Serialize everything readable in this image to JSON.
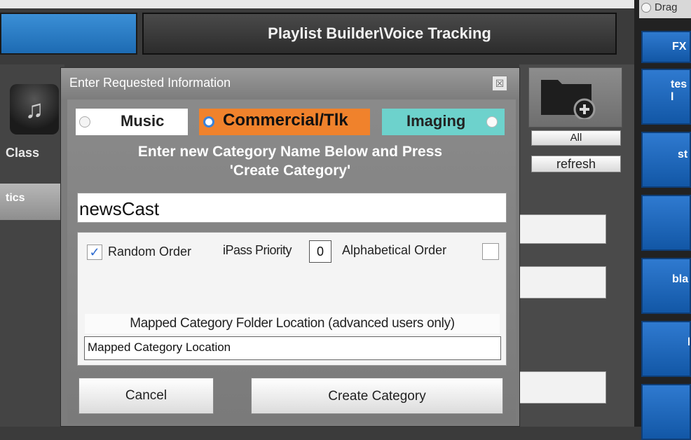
{
  "window": {
    "title": "Playlist Builder\\Voice Tracking"
  },
  "left_panel": {
    "class_label": "Class",
    "stats_tab": "tics"
  },
  "library_panel": {
    "all_button": "All",
    "refresh_button": "refresh"
  },
  "right_column": {
    "drag_option": "Drag",
    "fx_button": "FX",
    "buttons": [
      "tes\nl",
      "st",
      "",
      "bla",
      "b",
      ""
    ]
  },
  "dialog": {
    "title": "Enter Requested Information",
    "close_glyph": "☒",
    "categories": {
      "music": "Music",
      "commercial": "Commercial/Tlk",
      "imaging": "Imaging",
      "selected": "Commercial/Tlk"
    },
    "instruction_line1": "Enter new Category Name Below and Press",
    "instruction_line2": "'Create Category'",
    "category_name_value": "newsCast",
    "random_order_label": "Random Order",
    "random_order_checked": true,
    "ipass_priority_label": "iPass Priority",
    "ipass_priority_value": "0",
    "alphabetical_order_label": "Alphabetical Order",
    "alphabetical_order_checked": false,
    "mapped_header": "Mapped Category Folder Location (advanced users only)",
    "mapped_value": "Mapped Category Location",
    "cancel_button": "Cancel",
    "create_button": "Create Category"
  },
  "colors": {
    "commercial": "#f0822c",
    "imaging": "#6dd2cc",
    "blue_button": "#1d6bb3"
  }
}
